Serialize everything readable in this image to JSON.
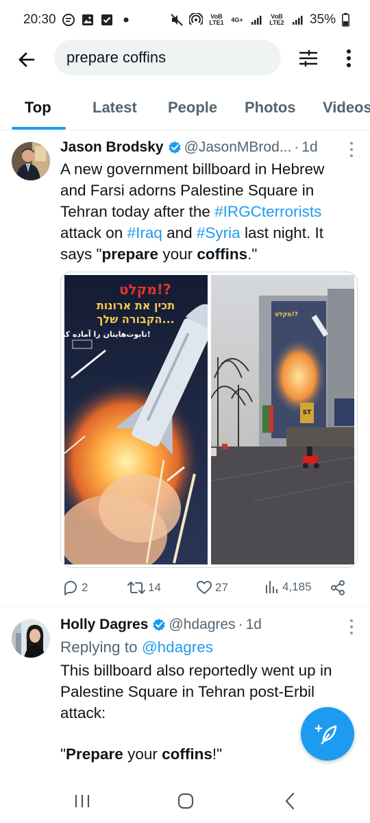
{
  "status_bar": {
    "time": "20:30",
    "volte1": "VoB LTE1",
    "net_4g": "4G+",
    "volte2": "VoB LTE2",
    "battery": "35%"
  },
  "search": {
    "query": "prepare coffins"
  },
  "tabs": [
    {
      "label": "Top",
      "active": true
    },
    {
      "label": "Latest"
    },
    {
      "label": "People"
    },
    {
      "label": "Photos"
    },
    {
      "label": "Videos"
    }
  ],
  "tweets": [
    {
      "name": "Jason Brodsky",
      "handle": "@JasonMBrod...",
      "time": "1d",
      "text_parts": {
        "p1": "A new government billboard in Hebrew and Farsi adorns Palestine Square in Tehran today after the ",
        "l1": "#IRGCterrorists",
        "p2": " attack on ",
        "l2": "#Iraq",
        "p3": " and ",
        "l3": "#Syria",
        "p4": " last night. It says \"",
        "b1": "prepare",
        "p5": " your ",
        "b2": "coffins",
        "p6": ".\""
      },
      "media": {
        "poster_title": "מקלט!?",
        "poster_line1": "תכין את ארונות",
        "poster_line2": "הקבורה שלך...",
        "poster_farsi": "تابوت‌هایتان را آماده کنید!",
        "shop_sign": "ST"
      },
      "stats": {
        "replies": "2",
        "retweets": "14",
        "likes": "27",
        "views": "4,185"
      }
    },
    {
      "name": "Holly Dagres",
      "handle": "@hdagres",
      "time": "1d",
      "replying_label": "Replying to ",
      "replying_handle": "@hdagres",
      "text": "This billboard also reportedly went up in Palestine Square in Tehran post-Erbil attack:",
      "quote": {
        "q1": "\"",
        "b1": "Prepare",
        "q2": " your ",
        "b2": "coffins",
        "q3": "!\""
      }
    }
  ],
  "colors": {
    "accent": "#1d9bf0",
    "text": "#0f1419",
    "secondary": "#536471"
  }
}
